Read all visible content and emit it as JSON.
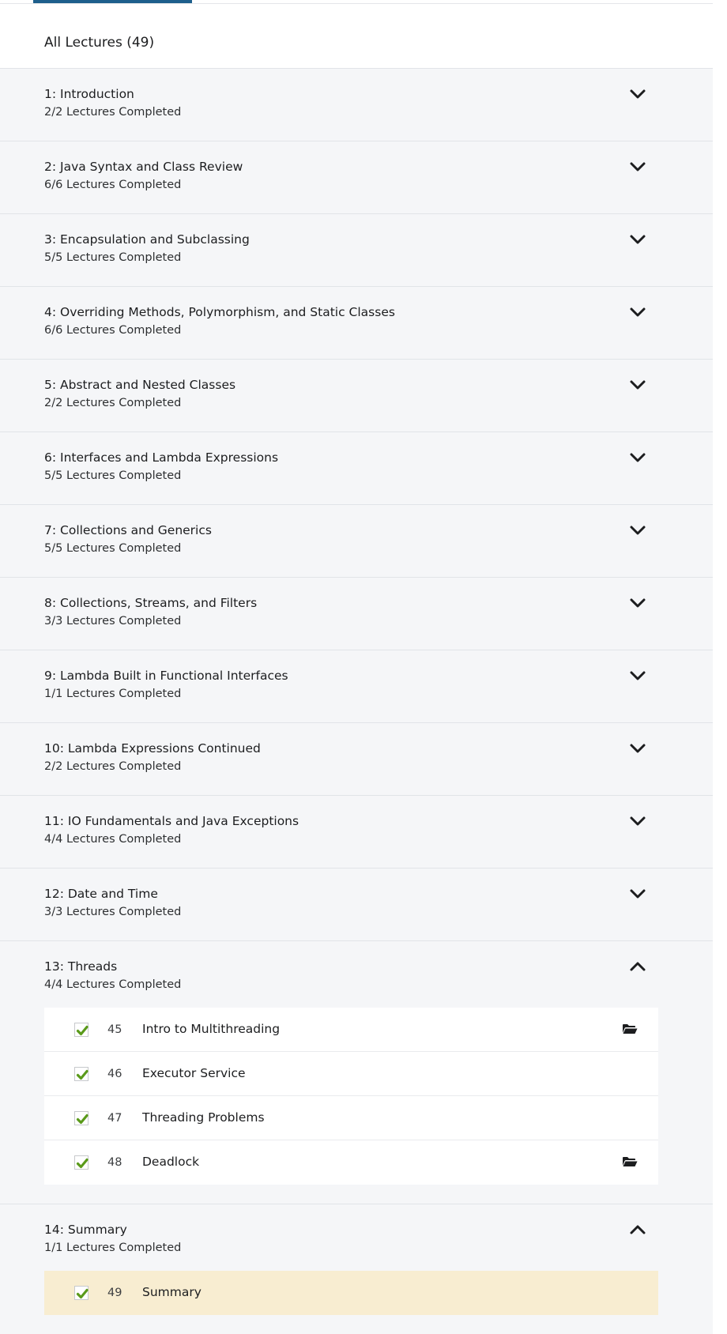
{
  "lectures_header": {
    "title": "All Lectures (49)"
  },
  "colors": {
    "accent": "#1e5f8c",
    "check": "#5a9a1a",
    "current_row": "#f8edd1",
    "section_bg": "#f5f6f8"
  },
  "sections": [
    {
      "title": "1: Introduction",
      "progress": "2/2 Lectures Completed",
      "state": "collapsed",
      "icon": "chevron-down-icon"
    },
    {
      "title": "2: Java Syntax and Class Review",
      "progress": "6/6 Lectures Completed",
      "state": "collapsed",
      "icon": "chevron-down-icon"
    },
    {
      "title": "3: Encapsulation and Subclassing",
      "progress": "5/5 Lectures Completed",
      "state": "collapsed",
      "icon": "chevron-down-icon"
    },
    {
      "title": "4: Overriding Methods, Polymorphism, and Static Classes",
      "progress": "6/6 Lectures Completed",
      "state": "collapsed",
      "icon": "chevron-down-icon"
    },
    {
      "title": "5: Abstract and Nested Classes",
      "progress": "2/2 Lectures Completed",
      "state": "collapsed",
      "icon": "chevron-down-icon"
    },
    {
      "title": "6: Interfaces and Lambda Expressions",
      "progress": "5/5 Lectures Completed",
      "state": "collapsed",
      "icon": "chevron-down-icon"
    },
    {
      "title": "7: Collections and Generics",
      "progress": "5/5 Lectures Completed",
      "state": "collapsed",
      "icon": "chevron-down-icon"
    },
    {
      "title": "8: Collections, Streams, and Filters",
      "progress": "3/3 Lectures Completed",
      "state": "collapsed",
      "icon": "chevron-down-icon"
    },
    {
      "title": "9: Lambda Built in Functional Interfaces",
      "progress": "1/1 Lectures Completed",
      "state": "collapsed",
      "icon": "chevron-down-icon"
    },
    {
      "title": "10: Lambda Expressions Continued",
      "progress": "2/2 Lectures Completed",
      "state": "collapsed",
      "icon": "chevron-down-icon"
    },
    {
      "title": "11: IO Fundamentals and Java Exceptions",
      "progress": "4/4 Lectures Completed",
      "state": "collapsed",
      "icon": "chevron-down-icon"
    },
    {
      "title": "12: Date and Time",
      "progress": "3/3 Lectures Completed",
      "state": "collapsed",
      "icon": "chevron-down-icon"
    },
    {
      "title": "13: Threads",
      "progress": "4/4 Lectures Completed",
      "state": "expanded",
      "icon": "chevron-up-icon",
      "lectures": [
        {
          "number": "45",
          "title": "Intro to Multithreading",
          "completed": true,
          "resources_icon": "folder-open-icon"
        },
        {
          "number": "46",
          "title": "Executor Service",
          "completed": true
        },
        {
          "number": "47",
          "title": "Threading Problems",
          "completed": true
        },
        {
          "number": "48",
          "title": "Deadlock",
          "completed": true,
          "resources_icon": "folder-open-icon"
        }
      ]
    },
    {
      "title": "14: Summary",
      "progress": "1/1 Lectures Completed",
      "state": "expanded",
      "icon": "chevron-up-icon",
      "lectures": [
        {
          "number": "49",
          "title": "Summary",
          "completed": true,
          "current": true
        }
      ]
    }
  ]
}
